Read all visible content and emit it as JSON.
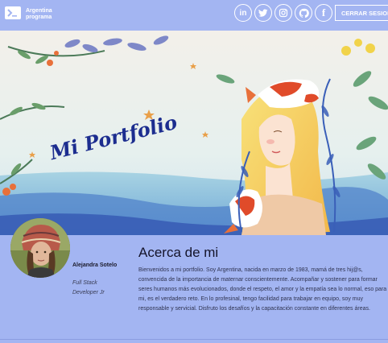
{
  "header": {
    "brand_line1": "Argentina",
    "brand_line2": "programa",
    "logout_label": "CERRAR SESION",
    "social": [
      {
        "icon": "linkedin-icon",
        "glyph": "in"
      },
      {
        "icon": "twitter-icon",
        "glyph": "🐦"
      },
      {
        "icon": "instagram-icon",
        "glyph": "◎"
      },
      {
        "icon": "github-icon",
        "glyph": "⚲"
      },
      {
        "icon": "facebook-icon",
        "glyph": "f"
      }
    ]
  },
  "banner": {
    "title": "Mi Portfolio"
  },
  "profile": {
    "name": "Alejandra Sotelo",
    "role_line1": "Full Stack",
    "role_line2": "Developer Jr"
  },
  "about": {
    "title": "Acerca de mi",
    "text": "Bienvenidos a mi portfolio. Soy Argentina, nacida en marzo de 1983, mamá de tres hij@s, convencida de la importancia de maternar conscientemente. Acompañar y sostener para formar seres humanos más evolucionados, donde el respeto, el amor y la empatía sea lo normal, eso para mi, es el verdadero reto. En lo profesinal, tengo facilidad para trabajar en equipo, soy muy responsable y servicial. Disfruto los desafíos y la capacitación constante en diferentes áreas."
  },
  "colors": {
    "background": "#a3b5f2",
    "title_blue": "#1c2d8f",
    "text_dark": "#14142a"
  }
}
